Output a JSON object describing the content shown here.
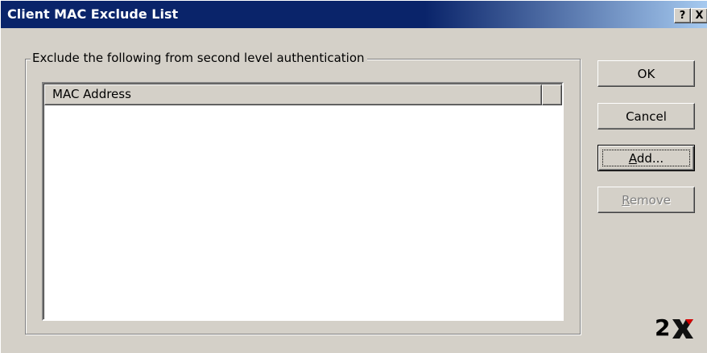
{
  "window": {
    "title": "Client MAC Exclude List",
    "help_label": "?",
    "close_label": "X"
  },
  "group": {
    "legend": "Exclude the following from second level authentication"
  },
  "list": {
    "columns": [
      "MAC Address"
    ],
    "rows": []
  },
  "buttons": {
    "ok": "OK",
    "cancel": "Cancel",
    "add_accel": "A",
    "add_rest": "dd...",
    "remove_accel": "R",
    "remove_rest": "emove"
  },
  "logo": {
    "text": "2X"
  },
  "colors": {
    "titlebar_start": "#0a246a",
    "titlebar_end": "#a6caf0",
    "face": "#d4d0c8",
    "disabled_text": "#808080"
  }
}
